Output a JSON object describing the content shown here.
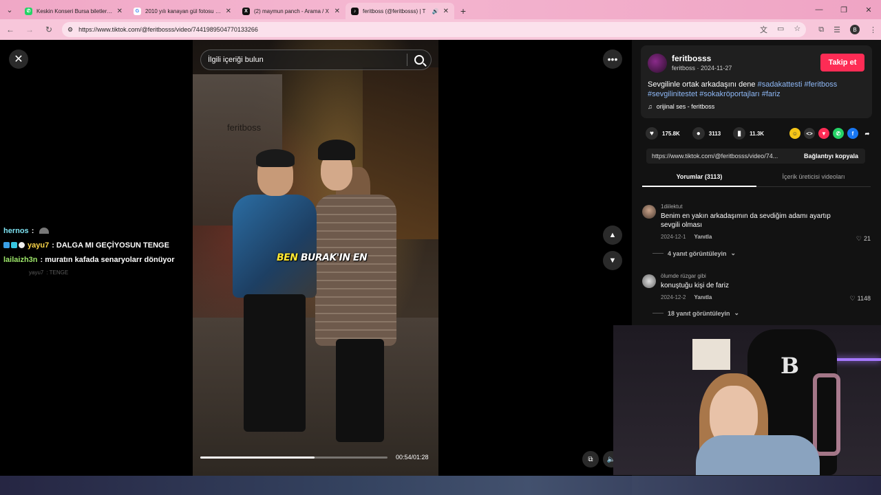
{
  "browser": {
    "tabs": [
      {
        "title": "Keskin Konseri Bursa biletleri | B",
        "icon": "whatsapp-icon",
        "color": "#25d366",
        "active": false
      },
      {
        "title": "2010 yılı kanayan gül fotosu - G",
        "icon": "google-icon",
        "color": "#4285f4",
        "active": false
      },
      {
        "title": "(2) maymun panch - Arama / X",
        "icon": "x-icon",
        "color": "#111111",
        "active": false
      },
      {
        "title": "feritboss (@feritbosss) | T",
        "icon": "tiktok-icon",
        "color": "#111111",
        "active": true
      }
    ],
    "url": "https://www.tiktok.com/@feritbosss/video/7441989504770133266",
    "profile_initial": "B"
  },
  "video": {
    "search_placeholder": "İlgili içeriği bulun",
    "watermark": "feritboss",
    "caption_left": "BEN",
    "caption_right": "BURAK'IN EN",
    "progress": 0.61,
    "time": "00:54/01:28"
  },
  "chat": [
    {
      "user": "hernos",
      "message": "",
      "color": "#7ee3f2"
    },
    {
      "user": "yayu7",
      "message": ": DALGA MI GEÇİYOSUN TENGE",
      "color": "#ffd84a"
    },
    {
      "user": "lailaizh3n",
      "message": ": muratın kafada senaryolarr dönüyor",
      "color": "#9ee86a"
    },
    {
      "user": "yayu7",
      "message": ": TENGE",
      "color": "#999999"
    }
  ],
  "creator": {
    "name": "feritbosss",
    "sub": "feritboss · 2024-11-27",
    "follow_label": "Takip et",
    "desc_text": "Sevgilinle ortak arkadaşını dene ",
    "hashtags": [
      "#sadakattesti",
      "#feritboss",
      "#sevgilinitestet",
      "#sokakröportajları",
      "#fariz"
    ],
    "music": "orijinal ses - feritboss"
  },
  "stats": {
    "likes": "175.8K",
    "comments": "3113",
    "saves": "11.3K"
  },
  "link": {
    "url": "https://www.tiktok.com/@feritbosss/video/74...",
    "copy_label": "Bağlantıyı kopyala"
  },
  "tabs": {
    "comments": "Yorumlar (3113)",
    "creator_videos": "İçerik üreticisi videoları"
  },
  "comments": [
    {
      "user": "1diilektut",
      "text": "Benim en yakın arkadaşımın da sevdiğim adamı ayartıp sevgili olması",
      "date": "2024-12-1",
      "reply": "Yanıtla",
      "likes": "21",
      "replies": "4 yanıt görüntüleyin"
    },
    {
      "user": "ölumde rüzgar gibi",
      "text": "konuştuğu kişi de fariz",
      "date": "2024-12-2",
      "reply": "Yanıtla",
      "likes": "1148",
      "replies": "18 yanıt görüntüleyin"
    }
  ]
}
